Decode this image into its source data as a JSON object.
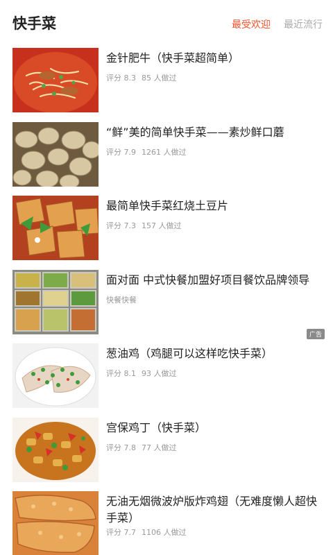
{
  "header": {
    "title": "快手菜",
    "tabs": [
      {
        "label": "最受欢迎",
        "active": true
      },
      {
        "label": "最近流行",
        "active": false
      }
    ]
  },
  "recipes": [
    {
      "title": "金针肥牛（快手菜超简单）",
      "rating_label": "评分 8.3",
      "made_count": "85 人做过",
      "image": "spicy-beef-enoki"
    },
    {
      "title": "“鲜”美的简单快手菜——素炒鲜口蘑",
      "rating_label": "评分 7.9",
      "made_count": "1261 人做过",
      "image": "stir-fried-mushrooms"
    },
    {
      "title": "最简单快手菜红烧土豆片",
      "rating_label": "评分 7.3",
      "made_count": "157 人做过",
      "image": "braised-potato-slices"
    },
    {
      "title": "面对面 中式快餐加盟好项目餐饮品牌领导",
      "subtitle": "快餐快餐",
      "ad_label": "广告",
      "image": "fast-food-trays"
    },
    {
      "title": "葱油鸡（鸡腿可以这样吃快手菜）",
      "rating_label": "评分 8.1",
      "made_count": "93 人做过",
      "image": "scallion-oil-chicken"
    },
    {
      "title": "宫保鸡丁（快手菜）",
      "rating_label": "评分 7.8",
      "made_count": "77 人做过",
      "image": "kung-pao-chicken"
    },
    {
      "title": "无油无烟微波炉版炸鸡翅（无难度懒人超快手菜）",
      "rating_label": "评分 7.7",
      "made_count": "1106 人做过",
      "image": "fried-chicken-wings"
    }
  ],
  "colors": {
    "accent": "#f0542f",
    "muted": "#999999",
    "text": "#222222"
  }
}
